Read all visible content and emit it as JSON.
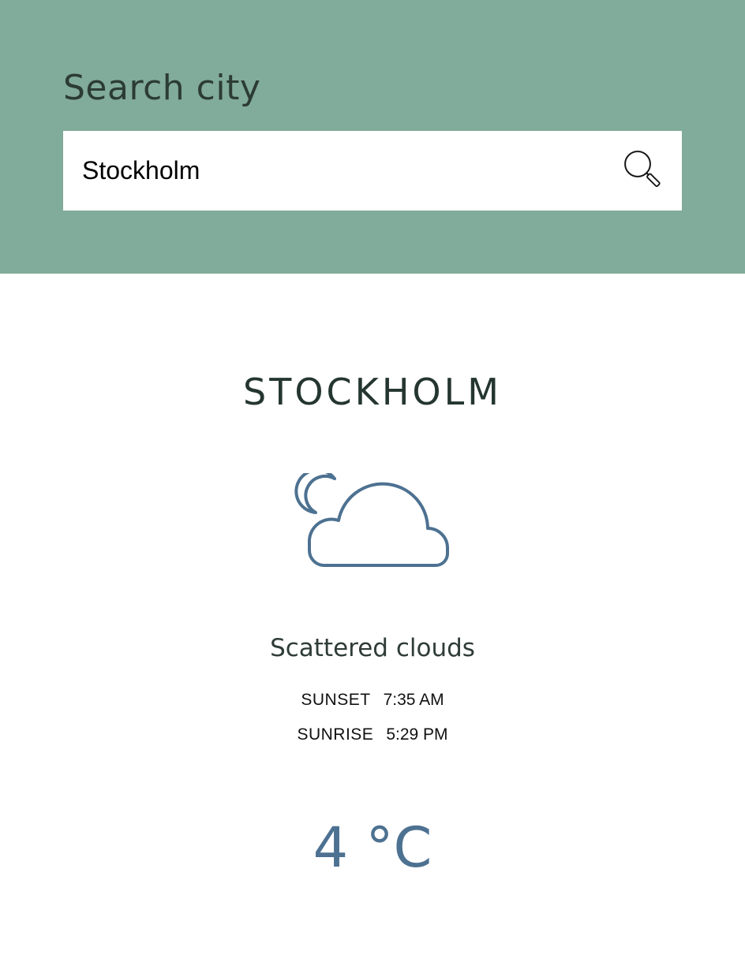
{
  "search": {
    "title": "Search city",
    "value": "Stockholm",
    "placeholder": ""
  },
  "search_icon": "magnifier-icon",
  "weather": {
    "city": "STOCKHOLM",
    "icon": "cloud-moon-icon",
    "description": "Scattered clouds",
    "sunset_label": "SUNSET",
    "sunset_time": "7:35 AM",
    "sunrise_label": "SUNRISE",
    "sunrise_time": "5:29 PM",
    "temperature": "4 °C"
  },
  "colors": {
    "header_bg": "#81ab9a",
    "accent": "#4d7191",
    "text_dark": "#24362f"
  }
}
